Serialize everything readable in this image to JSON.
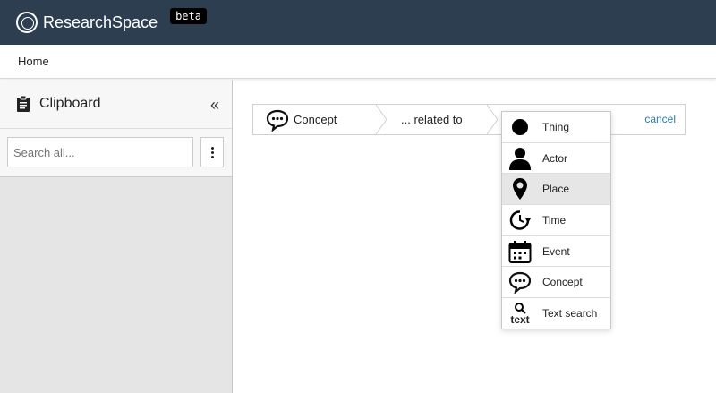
{
  "header": {
    "app_name": "ResearchSpace",
    "badge": "beta",
    "bg_color": "#2e3e51"
  },
  "breadcrumb": {
    "home": "Home"
  },
  "clipboard": {
    "title": "Clipboard",
    "search_placeholder": "Search all..."
  },
  "query": {
    "segment1": "Concept",
    "segment2": "... related to",
    "cancel": "cancel"
  },
  "dropdown": {
    "items": [
      {
        "label": "Thing",
        "icon": "circle-icon"
      },
      {
        "label": "Actor",
        "icon": "person-icon"
      },
      {
        "label": "Place",
        "icon": "map-pin-icon",
        "active": true
      },
      {
        "label": "Time",
        "icon": "clock-icon"
      },
      {
        "label": "Event",
        "icon": "calendar-icon"
      },
      {
        "label": "Concept",
        "icon": "speech-bubble-icon"
      },
      {
        "label": "Text search",
        "icon": "text-search-icon",
        "icon_text": "text"
      }
    ]
  },
  "colors": {
    "link": "#2a7ab8",
    "active_row": "#e6e6e6"
  }
}
